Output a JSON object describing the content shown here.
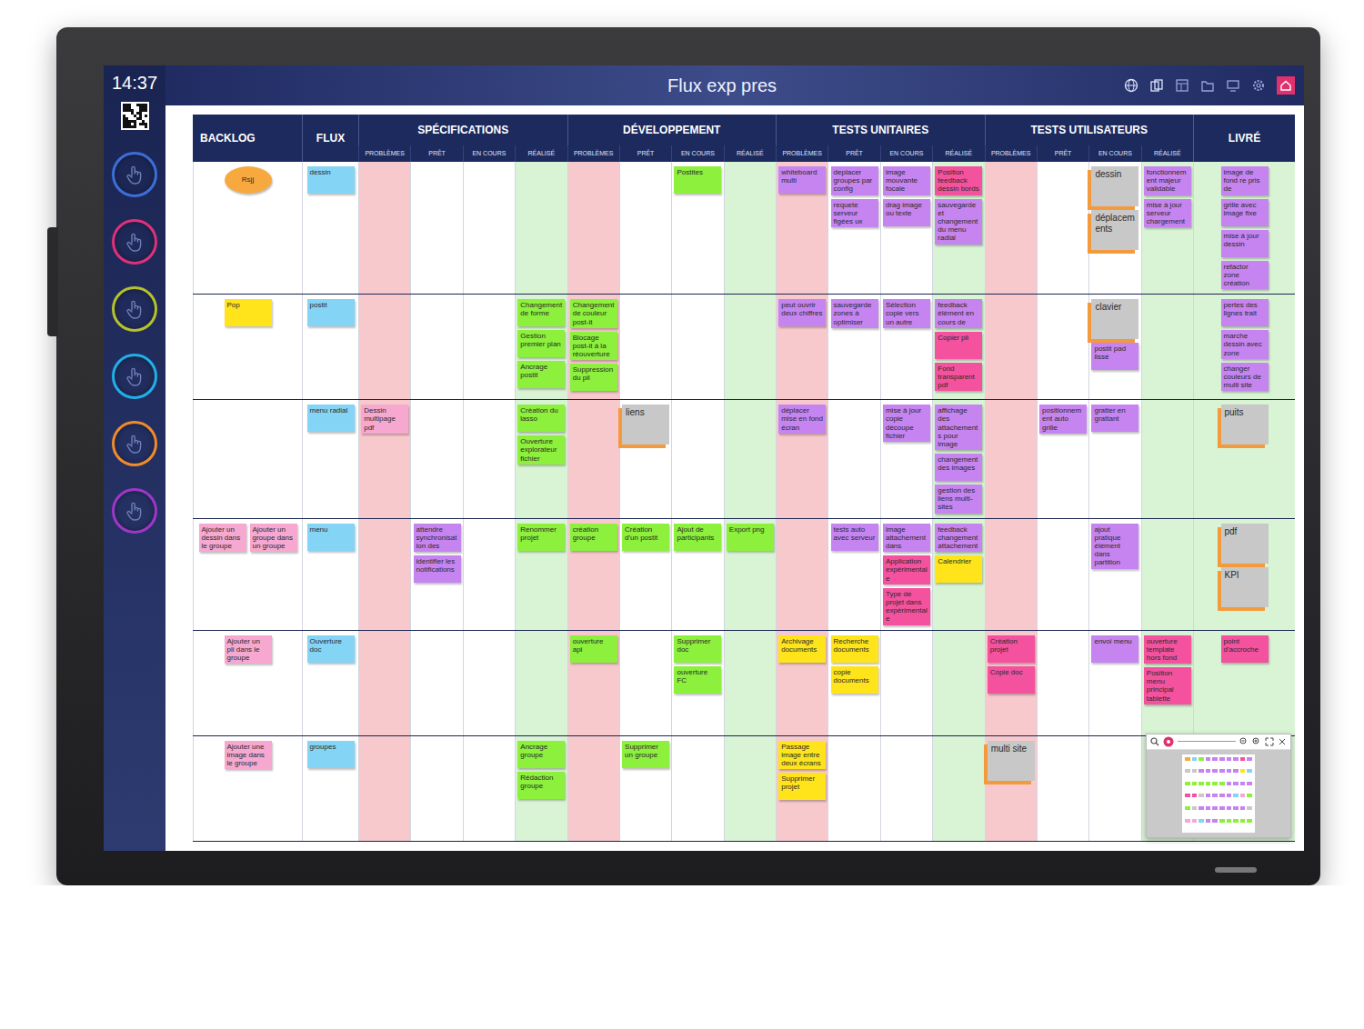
{
  "sidebar": {
    "time": "14:37",
    "tools": [
      {
        "color": "#3a6fd8"
      },
      {
        "color": "#e0307a"
      },
      {
        "color": "#b5c22a"
      },
      {
        "color": "#1fb0e8"
      },
      {
        "color": "#f08a2a"
      },
      {
        "color": "#a035c8"
      }
    ]
  },
  "board": {
    "title": "Flux exp pres",
    "groups": [
      {
        "label": "BACKLOG",
        "kind": "backlog",
        "sub": []
      },
      {
        "label": "FLUX",
        "kind": "flow",
        "sub": []
      },
      {
        "label": "SPÉCIFICATIONS",
        "kind": "stage",
        "sub": [
          {
            "label": "PROBLÈMES",
            "kind": "problem"
          },
          {
            "label": "PRÊT",
            "kind": "ready"
          },
          {
            "label": "EN COURS",
            "kind": "doing"
          },
          {
            "label": "RÉALISÉ",
            "kind": "done"
          }
        ]
      },
      {
        "label": "DÉVELOPPEMENT",
        "kind": "stage",
        "sub": [
          {
            "label": "PROBLÈMES",
            "kind": "problem"
          },
          {
            "label": "PRÊT",
            "kind": "ready"
          },
          {
            "label": "EN COURS",
            "kind": "doing"
          },
          {
            "label": "RÉALISÉ",
            "kind": "done"
          }
        ]
      },
      {
        "label": "TESTS UNITAIRES",
        "kind": "stage",
        "sub": [
          {
            "label": "PROBLÈMES",
            "kind": "problem"
          },
          {
            "label": "PRÊT",
            "kind": "ready"
          },
          {
            "label": "EN COURS",
            "kind": "doing"
          },
          {
            "label": "RÉALISÉ",
            "kind": "done"
          }
        ]
      },
      {
        "label": "TESTS UTILISATEURS",
        "kind": "stage",
        "sub": [
          {
            "label": "PROBLÈMES",
            "kind": "problem"
          },
          {
            "label": "PRÊT",
            "kind": "ready"
          },
          {
            "label": "EN COURS",
            "kind": "doing"
          },
          {
            "label": "RÉALISÉ",
            "kind": "done"
          }
        ]
      },
      {
        "label": "LIVRÉ",
        "kind": "delivered",
        "sub": []
      }
    ],
    "rows": [
      {
        "cells": [
          [
            {
              "text": "Rsjj",
              "color": "#f7a940",
              "kind": "ellipse"
            }
          ],
          [
            {
              "text": "dessin",
              "color": "#84d4f6",
              "kind": "sticky"
            }
          ],
          [],
          [],
          [],
          [],
          [],
          [],
          [
            {
              "text": "Postites",
              "color": "#8cf03c",
              "kind": "sticky"
            }
          ],
          [],
          [
            {
              "text": "whiteboard multi",
              "color": "#c684f0",
              "kind": "sticky"
            }
          ],
          [
            {
              "text": "deplacer groupes par config",
              "color": "#c684f0",
              "kind": "sticky"
            },
            {
              "text": "requete serveur figées ux",
              "color": "#c684f0",
              "kind": "sticky"
            }
          ],
          [
            {
              "text": "image mouvante focale",
              "color": "#c684f0",
              "kind": "sticky"
            },
            {
              "text": "drag image ou texte",
              "color": "#c684f0",
              "kind": "sticky"
            }
          ],
          [
            {
              "text": "Position feedback dessin bords",
              "color": "#f4529f",
              "kind": "sticky"
            },
            {
              "text": "sauvegarde et changement du menu radial",
              "color": "#c684f0",
              "kind": "sticky"
            }
          ],
          [],
          [],
          [
            {
              "text": "dessin",
              "color": "#c8c8c8",
              "kind": "card"
            },
            {
              "text": "déplacements",
              "color": "#c8c8c8",
              "kind": "card"
            }
          ],
          [
            {
              "text": "fonctionnement majeur validable",
              "color": "#c684f0",
              "kind": "sticky"
            },
            {
              "text": "mise à jour serveur chargement",
              "color": "#c684f0",
              "kind": "sticky"
            }
          ],
          [
            {
              "text": "image de fond re pris de",
              "color": "#c684f0",
              "kind": "sticky"
            },
            {
              "text": "grille avec image fixe",
              "color": "#c684f0",
              "kind": "sticky"
            },
            {
              "text": "mise à jour dessin",
              "color": "#c684f0",
              "kind": "sticky"
            },
            {
              "text": "refactor zone création",
              "color": "#c684f0",
              "kind": "sticky"
            }
          ]
        ]
      },
      {
        "cells": [
          [
            {
              "text": "Pop",
              "color": "#ffe41c",
              "kind": "sticky"
            }
          ],
          [
            {
              "text": "postit",
              "color": "#84d4f6",
              "kind": "sticky"
            }
          ],
          [],
          [],
          [],
          [
            {
              "text": "Changement de forme",
              "color": "#8cf03c",
              "kind": "sticky"
            },
            {
              "text": "Gestion premier plan",
              "color": "#8cf03c",
              "kind": "sticky"
            },
            {
              "text": "Ancrage postit",
              "color": "#8cf03c",
              "kind": "sticky"
            }
          ],
          [
            {
              "text": "Changement de couleur post-it",
              "color": "#8cf03c",
              "kind": "sticky"
            },
            {
              "text": "Blocage post-it à la réouverture",
              "color": "#8cf03c",
              "kind": "sticky"
            },
            {
              "text": "Suppression du pli",
              "color": "#8cf03c",
              "kind": "sticky"
            }
          ],
          [],
          [],
          [],
          [
            {
              "text": "peut ouvrir deux chiffres",
              "color": "#c684f0",
              "kind": "sticky"
            }
          ],
          [
            {
              "text": "sauvegarde zones à optimiser",
              "color": "#c684f0",
              "kind": "sticky"
            }
          ],
          [
            {
              "text": "Sélection copie vers un autre",
              "color": "#c684f0",
              "kind": "sticky"
            }
          ],
          [
            {
              "text": "feedback élément en cours de",
              "color": "#c684f0",
              "kind": "sticky"
            },
            {
              "text": "Copier pli",
              "color": "#f4529f",
              "kind": "sticky"
            },
            {
              "text": "Fond transparent pdf",
              "color": "#f4529f",
              "kind": "sticky"
            }
          ],
          [],
          [],
          [
            {
              "text": "clavier",
              "color": "#c8c8c8",
              "kind": "card"
            },
            {
              "text": "postit pad lissé",
              "color": "#c684f0",
              "kind": "sticky"
            }
          ],
          [],
          [
            {
              "text": "pertes des lignes trait",
              "color": "#c684f0",
              "kind": "sticky"
            },
            {
              "text": "marche dessin avec zone",
              "color": "#c684f0",
              "kind": "sticky"
            },
            {
              "text": "changer couleurs de multi site",
              "color": "#c684f0",
              "kind": "sticky"
            }
          ]
        ]
      },
      {
        "cells": [
          [],
          [
            {
              "text": "menu radial",
              "color": "#84d4f6",
              "kind": "sticky"
            }
          ],
          [
            {
              "text": "Dessin multipage pdf",
              "color": "#f7a8d0",
              "kind": "sticky"
            }
          ],
          [],
          [],
          [
            {
              "text": "Création du lasso",
              "color": "#8cf03c",
              "kind": "sticky"
            },
            {
              "text": "Ouverture explorateur fichier",
              "color": "#8cf03c",
              "kind": "sticky"
            }
          ],
          [],
          [
            {
              "text": "liens",
              "color": "#c8c8c8",
              "kind": "card"
            }
          ],
          [],
          [],
          [
            {
              "text": "déplacer mise en fond écran",
              "color": "#c684f0",
              "kind": "sticky"
            }
          ],
          [],
          [
            {
              "text": "mise à jour copie découpe fichier",
              "color": "#c684f0",
              "kind": "sticky"
            }
          ],
          [
            {
              "text": "affichage des attachements pour image",
              "color": "#c684f0",
              "kind": "sticky"
            },
            {
              "text": "changement des images",
              "color": "#c684f0",
              "kind": "sticky"
            },
            {
              "text": "gestion des liens multi-sites",
              "color": "#c684f0",
              "kind": "sticky"
            }
          ],
          [],
          [
            {
              "text": "positionnement auto grille",
              "color": "#c684f0",
              "kind": "sticky"
            }
          ],
          [
            {
              "text": "gratter en grattant",
              "color": "#c684f0",
              "kind": "sticky"
            }
          ],
          [],
          [
            {
              "text": "puits",
              "color": "#c8c8c8",
              "kind": "card"
            }
          ]
        ]
      },
      {
        "cells": [
          [
            {
              "text": "Ajouter un dessin dans le groupe",
              "color": "#f7a8d0",
              "kind": "sticky"
            },
            {
              "text": "Ajouter un groupe dans un groupe",
              "color": "#f7a8d0",
              "kind": "sticky"
            }
          ],
          [
            {
              "text": "menu",
              "color": "#84d4f6",
              "kind": "sticky"
            }
          ],
          [],
          [
            {
              "text": "attendre synchronisation des",
              "color": "#c684f0",
              "kind": "sticky"
            },
            {
              "text": "identifier les notifications",
              "color": "#c684f0",
              "kind": "sticky"
            }
          ],
          [],
          [
            {
              "text": "Renommer projet",
              "color": "#8cf03c",
              "kind": "sticky"
            }
          ],
          [
            {
              "text": "création groupe",
              "color": "#8cf03c",
              "kind": "sticky"
            }
          ],
          [
            {
              "text": "Création d'un postit",
              "color": "#8cf03c",
              "kind": "sticky"
            }
          ],
          [
            {
              "text": "Ajout de participants",
              "color": "#8cf03c",
              "kind": "sticky"
            }
          ],
          [
            {
              "text": "Export png",
              "color": "#8cf03c",
              "kind": "sticky"
            }
          ],
          [],
          [
            {
              "text": "tests auto avec serveur",
              "color": "#c684f0",
              "kind": "sticky"
            }
          ],
          [
            {
              "text": "image attachement dans",
              "color": "#c684f0",
              "kind": "sticky"
            },
            {
              "text": "Application expérimentale",
              "color": "#f4529f",
              "kind": "sticky"
            },
            {
              "text": "Type de projet dans expérimentale",
              "color": "#f4529f",
              "kind": "sticky"
            }
          ],
          [
            {
              "text": "feedback changement attachement",
              "color": "#c684f0",
              "kind": "sticky"
            },
            {
              "text": "Calendrier",
              "color": "#ffe41c",
              "kind": "sticky"
            }
          ],
          [],
          [],
          [
            {
              "text": "ajout pratique élément dans partition",
              "color": "#c684f0",
              "kind": "sticky"
            }
          ],
          [],
          [
            {
              "text": "pdf",
              "color": "#c8c8c8",
              "kind": "card"
            },
            {
              "text": "KPI",
              "color": "#c8c8c8",
              "kind": "card"
            }
          ]
        ]
      },
      {
        "cells": [
          [
            {
              "text": "Ajouter un pli dans le groupe",
              "color": "#f7a8d0",
              "kind": "sticky"
            }
          ],
          [
            {
              "text": "Ouverture doc",
              "color": "#84d4f6",
              "kind": "sticky"
            }
          ],
          [],
          [],
          [],
          [],
          [
            {
              "text": "ouverture api",
              "color": "#8cf03c",
              "kind": "sticky"
            }
          ],
          [],
          [
            {
              "text": "Supprimer doc",
              "color": "#8cf03c",
              "kind": "sticky"
            },
            {
              "text": "ouverture FC",
              "color": "#8cf03c",
              "kind": "sticky"
            }
          ],
          [],
          [
            {
              "text": "Archivage documents",
              "color": "#ffe41c",
              "kind": "sticky"
            }
          ],
          [
            {
              "text": "Recherche documents",
              "color": "#ffe41c",
              "kind": "sticky"
            },
            {
              "text": "copie documents",
              "color": "#ffe41c",
              "kind": "sticky"
            }
          ],
          [],
          [],
          [
            {
              "text": "Création projet",
              "color": "#f4529f",
              "kind": "sticky"
            },
            {
              "text": "Copie doc",
              "color": "#f4529f",
              "kind": "sticky"
            }
          ],
          [],
          [
            {
              "text": "envoi menu",
              "color": "#c684f0",
              "kind": "sticky"
            }
          ],
          [
            {
              "text": "ouverture template hors fond",
              "color": "#f4529f",
              "kind": "sticky"
            },
            {
              "text": "Position menu principal tablette",
              "color": "#f4529f",
              "kind": "sticky"
            }
          ],
          [
            {
              "text": "point d'accroche",
              "color": "#f4529f",
              "kind": "sticky"
            }
          ]
        ]
      },
      {
        "cells": [
          [
            {
              "text": "Ajouter une image dans le groupe",
              "color": "#f7a8d0",
              "kind": "sticky"
            }
          ],
          [
            {
              "text": "groupes",
              "color": "#84d4f6",
              "kind": "sticky"
            }
          ],
          [],
          [],
          [],
          [
            {
              "text": "Ancrage groupe",
              "color": "#8cf03c",
              "kind": "sticky"
            },
            {
              "text": "Rédaction groupe",
              "color": "#8cf03c",
              "kind": "sticky"
            }
          ],
          [],
          [
            {
              "text": "Supprimer un groupe",
              "color": "#8cf03c",
              "kind": "sticky"
            }
          ],
          [],
          [],
          [
            {
              "text": "Passage image entre deux écrans",
              "color": "#ffe41c",
              "kind": "sticky"
            },
            {
              "text": "Supprimer projet",
              "color": "#ffe41c",
              "kind": "sticky"
            }
          ],
          [],
          [],
          [],
          [
            {
              "text": "multi site",
              "color": "#c8c8c8",
              "kind": "card"
            }
          ],
          [],
          [],
          [],
          []
        ]
      }
    ]
  }
}
